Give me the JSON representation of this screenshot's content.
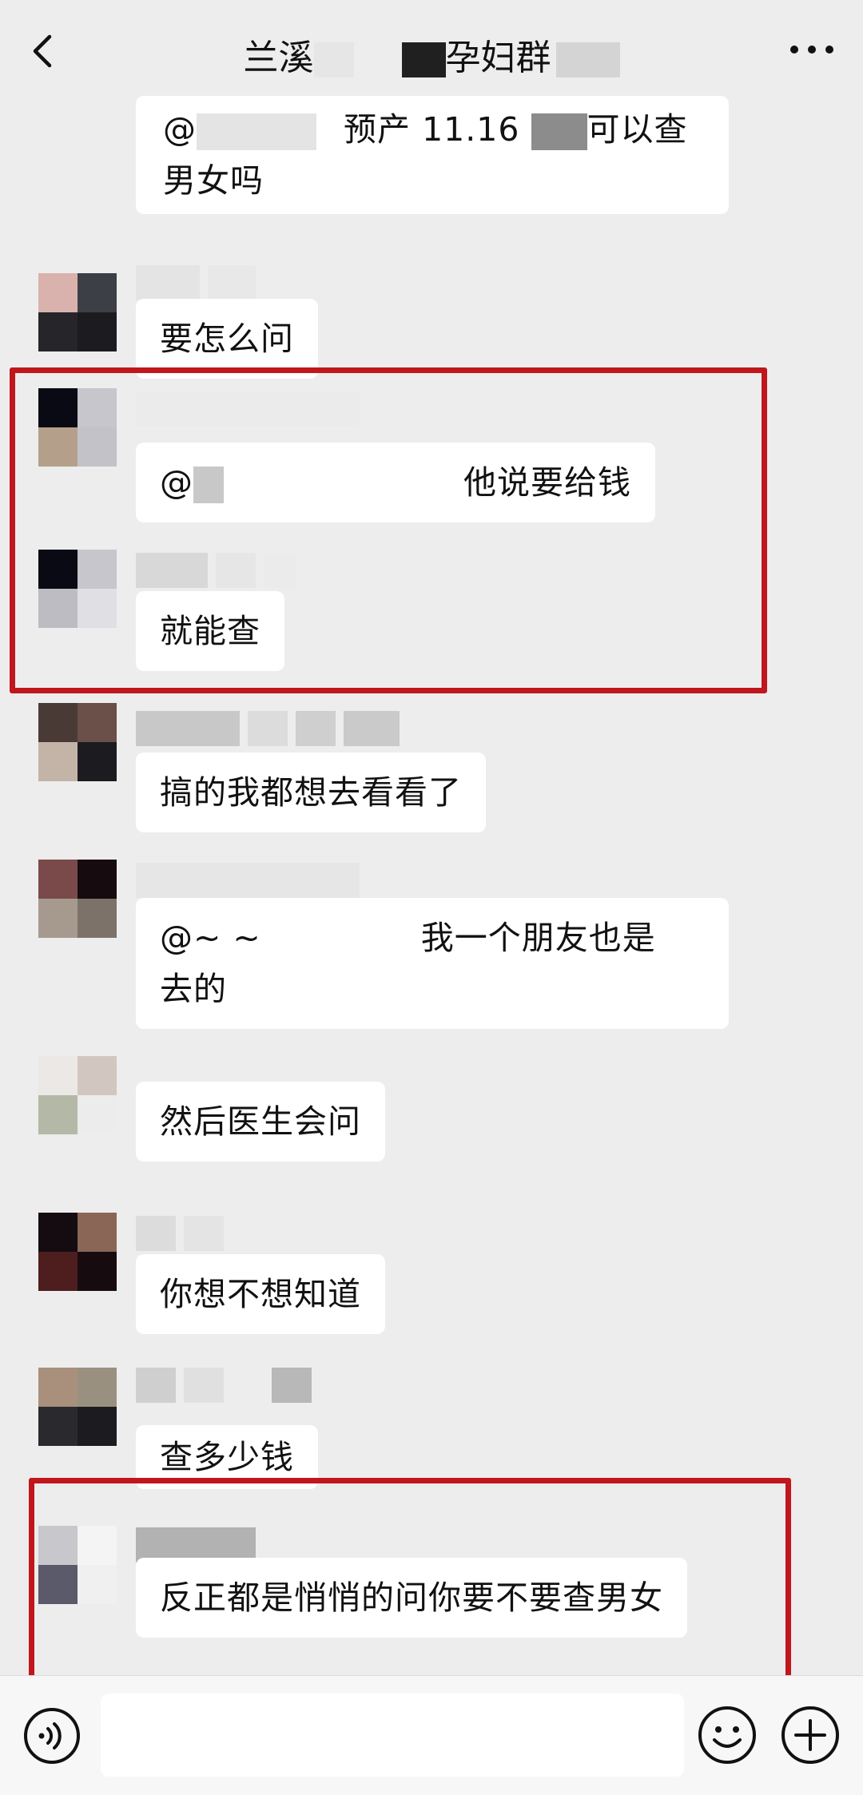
{
  "header": {
    "title_start": "兰溪",
    "title_end": "孕妇群"
  },
  "messages": [
    {
      "id": "m1",
      "text_before": "@",
      "text_after": "预产 11.16",
      "text_after2": "可以查",
      "line2": "男女吗"
    },
    {
      "id": "m2",
      "text": "要怎么问"
    },
    {
      "id": "m3",
      "text_before": "@",
      "text_after": "他说要给钱"
    },
    {
      "id": "m4",
      "text": "就能查"
    },
    {
      "id": "m5",
      "text": "搞的我都想去看看了"
    },
    {
      "id": "m6",
      "text_before": "@~ ~",
      "text_after": "我一个朋友也是",
      "line2": "去的"
    },
    {
      "id": "m7",
      "text": "然后医生会问"
    },
    {
      "id": "m8",
      "text": "你想不想知道"
    },
    {
      "id": "m9",
      "text": "查多少钱"
    },
    {
      "id": "m10",
      "text": "反正都是悄悄的问你要不要查男女"
    }
  ],
  "colors": {
    "background": "#ededed",
    "bubble": "#ffffff",
    "highlight_box": "#c0161c"
  },
  "icons": {
    "back": "chevron-left-icon",
    "more": "more-dots-icon",
    "voice": "voice-icon",
    "emoji": "emoji-icon",
    "plus": "plus-icon"
  }
}
